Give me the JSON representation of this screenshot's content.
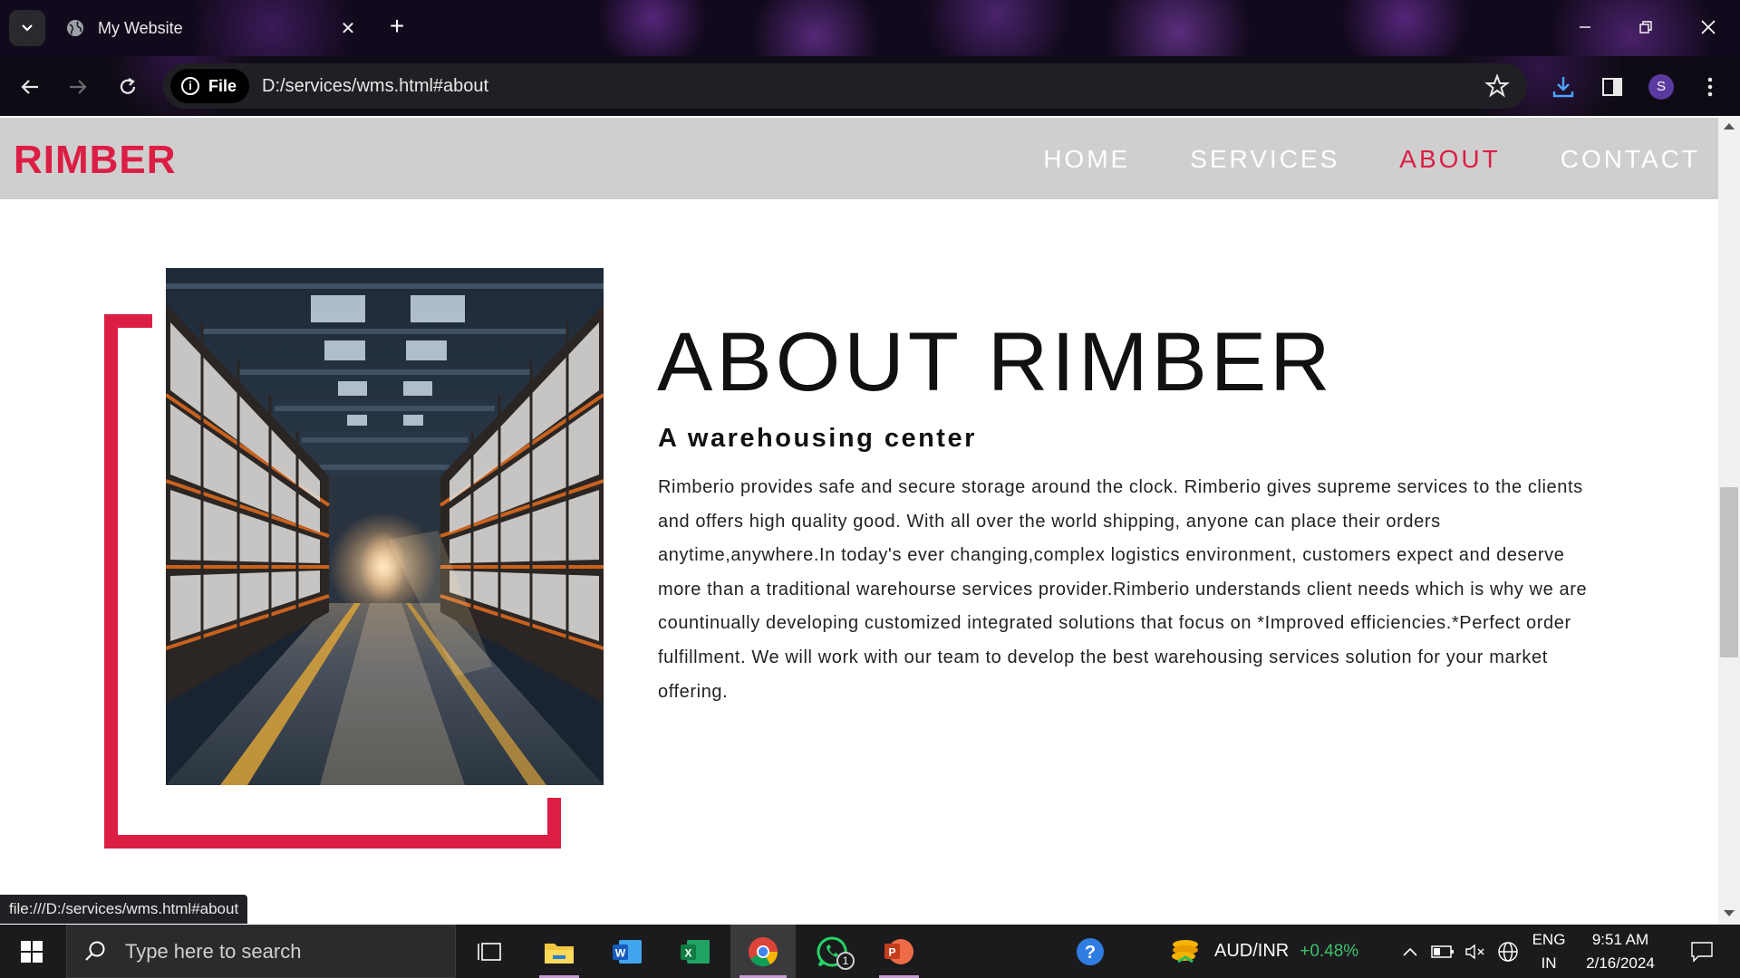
{
  "browser": {
    "tab_title": "My Website",
    "chip_label": "File",
    "url": "D:/services/wms.html#about",
    "profile_initial": "S",
    "status_url": "file:///D:/services/wms.html#about"
  },
  "site": {
    "logo": "RIMBER",
    "nav": [
      {
        "label": "HOME",
        "active": false
      },
      {
        "label": "SERVICES",
        "active": false
      },
      {
        "label": "ABOUT",
        "active": true
      },
      {
        "label": "CONTACT",
        "active": false
      }
    ],
    "about": {
      "title": "ABOUT RIMBER",
      "subtitle": "A warehousing center",
      "body": "Rimberio provides safe and secure storage around the clock. Rimberio gives supreme services to the clients and offers high quality good. With all over the world shipping, anyone can place their orders anytime,anywhere.In today's ever changing,complex logistics environment, customers expect and deserve more than a traditional warehourse services provider.Rimberio understands client needs which is why we are countinually developing customized integrated solutions that focus on *Improved efficiencies.*Perfect order fulfillment. We will work with our team to develop the best warehousing services solution for your market offering."
    },
    "accent_color": "#dc1e45",
    "header_bg": "#cfcfcf"
  },
  "taskbar": {
    "search_placeholder": "Type here to search",
    "whatsapp_badge": "1",
    "ticker_name": "AUD/INR",
    "ticker_change": "+0.48%",
    "language_top": "ENG",
    "language_bottom": "IN",
    "time": "9:51 AM",
    "date": "2/16/2024"
  }
}
